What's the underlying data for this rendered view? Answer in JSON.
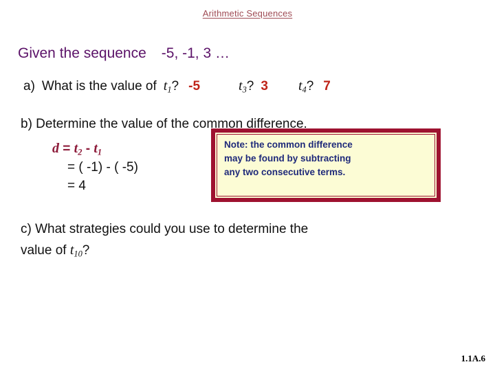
{
  "slide": {
    "title": "Arithmetic Sequences",
    "footer_code": "1.1A.6"
  },
  "given": {
    "label": "Given the sequence",
    "sequence": "-5, -1, 3 …"
  },
  "part_a": {
    "marker": "a)",
    "question": "What is the value of",
    "term1_var": "t",
    "term1_sub": "1",
    "term1_q": "?",
    "term1_answer": "-5",
    "term3_var": "t",
    "term3_sub": "3",
    "term3_q": "?",
    "term3_answer": "3",
    "term4_var": "t",
    "term4_sub": "4",
    "term4_q": "?",
    "term4_answer": "7"
  },
  "part_b": {
    "text": "b)  Determine the value of the common difference."
  },
  "work": {
    "line1_lead": "d",
    "line1_eq": " = ",
    "line1_t2_var": "t",
    "line1_t2_sub": "2",
    "line1_minus": " - ",
    "line1_t1_var": "t",
    "line1_t1_sub": "1",
    "line2": "= ( -1) - ( -5)",
    "line3": "= 4"
  },
  "note": {
    "line1": "Note:  the common difference",
    "line2": "may be found by subtracting",
    "line3": "any two consecutive terms."
  },
  "part_c": {
    "line1": "c)  What strategies could you use to determine the",
    "line2_lead": "value of ",
    "line2_var": "t",
    "line2_sub": "10",
    "line2_tail": "?"
  },
  "colors": {
    "title": "#9e4a53",
    "given_purple": "#5b1268",
    "answer_red": "#bf2419",
    "formula_maroon": "#8d1b3a",
    "note_border": "#9e1230",
    "note_background": "#fcfcd5",
    "note_text": "#1f2a7a",
    "body_text": "#111111"
  }
}
